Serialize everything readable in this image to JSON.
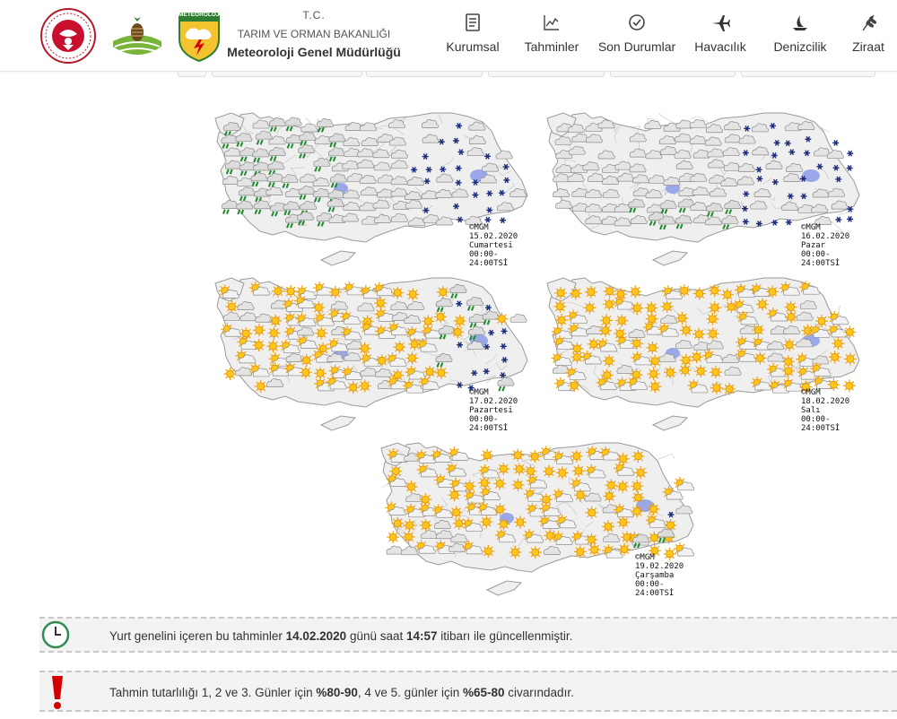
{
  "header": {
    "tc": "T.C.",
    "ministry": "TARIM VE ORMAN BAKANLIĞI",
    "org": "Meteoroloji Genel Müdürlüğü",
    "logo_tos_text": "TARIM ORMAN ŞURASI",
    "logo_meteo_text": "METEOROLOJI"
  },
  "nav": [
    {
      "label": "Kurumsal",
      "icon": "document-icon"
    },
    {
      "label": "Tahminler",
      "icon": "chart-icon"
    },
    {
      "label": "Son Durumlar",
      "icon": "clock-check-icon"
    },
    {
      "label": "Havacılık",
      "icon": "airplane-icon"
    },
    {
      "label": "Denizcilik",
      "icon": "sailboat-icon"
    },
    {
      "label": "Ziraat",
      "icon": "wheat-icon"
    }
  ],
  "maps": [
    {
      "copyright": "©MGM",
      "date": "15.02.2020",
      "day": "Cumartesi",
      "time": "00:00-24:00TSİ",
      "style": "rain-snow-west"
    },
    {
      "copyright": "©MGM",
      "date": "16.02.2020",
      "day": "Pazar",
      "time": "00:00-24:00TSİ",
      "style": "cloudy-snow"
    },
    {
      "copyright": "©MGM",
      "date": "17.02.2020",
      "day": "Pazartesi",
      "time": "00:00-24:00TSİ",
      "style": "partly-sunny-snow-east"
    },
    {
      "copyright": "©MGM",
      "date": "18.02.2020",
      "day": "Salı",
      "time": "00:00-24:00TSİ",
      "style": "sunny"
    },
    {
      "copyright": "©MGM",
      "date": "19.02.2020",
      "day": "Çarşamba",
      "time": "00:00-24:00TSİ",
      "style": "sunny"
    }
  ],
  "info": {
    "update_prefix": "Yurt genelini içeren bu tahminler ",
    "update_date": "14.02.2020",
    "update_mid": " günü saat ",
    "update_time": "14:57",
    "update_suffix": " itibarı ile güncellenmiştir.",
    "acc_prefix": "Tahmin tutarlılığı 1, 2 ve 3. Günler için ",
    "acc_1": "%80-90",
    "acc_mid": ", 4 ve 5. günler için ",
    "acc_2": "%65-80",
    "acc_suffix": " civarındadır."
  },
  "colors": {
    "accent_green": "#2e8b57",
    "alert_red": "#d40000",
    "map_fill": "#efefef",
    "map_stroke": "#9a9a9a",
    "lake": "#9aa7e8"
  }
}
